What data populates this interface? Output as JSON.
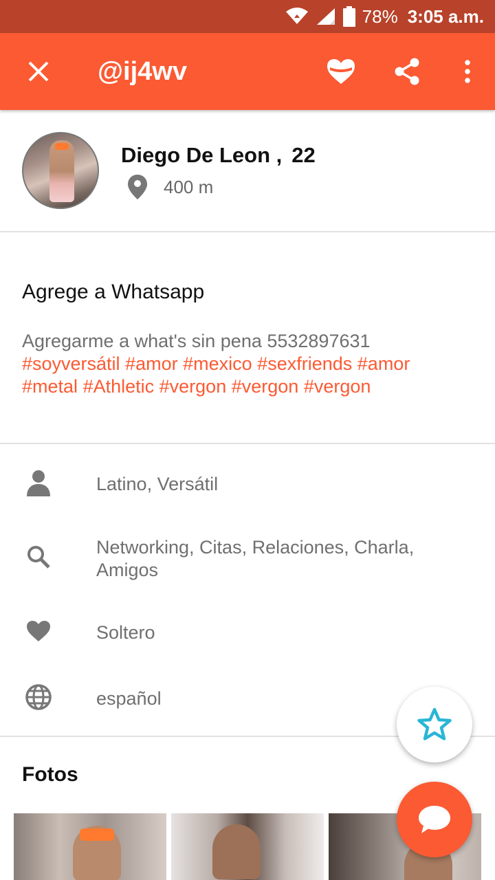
{
  "status_bar": {
    "battery": "78%",
    "time": "3:05 a.m."
  },
  "toolbar": {
    "title": "@ij4wv"
  },
  "profile": {
    "name": "Diego De Leon ,",
    "age": "22",
    "distance": "400 m"
  },
  "bio": {
    "title": "Agrege a Whatsapp",
    "text": "Agregarme a what's sin pena  5532897631",
    "tags": [
      "#soyversátil",
      "#amor",
      "#mexico",
      "#sexfriends",
      "#amor",
      "#metal",
      "#Athletic",
      "#vergon",
      "#vergon",
      "#vergon"
    ]
  },
  "details": {
    "identity": "Latino,  Versátil",
    "looking_for": "Networking,  Citas,  Relaciones,  Charla,  Amigos",
    "relationship": "Soltero",
    "language": "español"
  },
  "photos": {
    "title": "Fotos"
  },
  "colors": {
    "accent": "#fb5a33",
    "status_bar": "#b8432a",
    "star": "#29b6d6"
  }
}
